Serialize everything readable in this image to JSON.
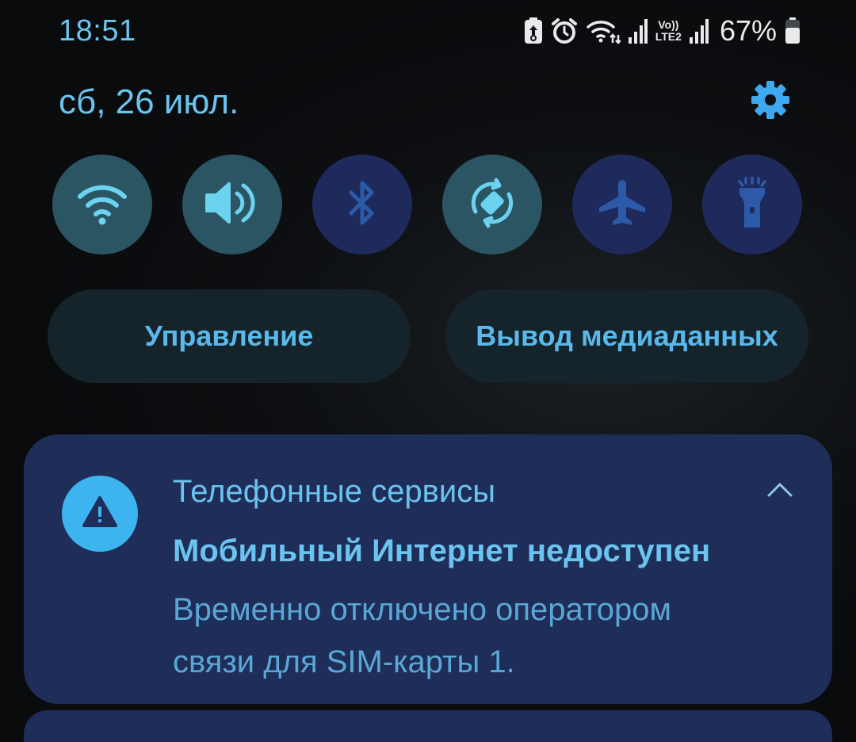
{
  "status_bar": {
    "time": "18:51",
    "icons": [
      "battery-saver-icon",
      "alarm-icon",
      "wifi-data-icon",
      "signal-icon",
      "volte-lte2-icon",
      "signal-icon-2",
      "battery-icon"
    ],
    "volte_label_top": "Vo))",
    "volte_label_bottom": "LTE2",
    "battery_percent": "67%",
    "battery_level": 0.67
  },
  "header": {
    "date": "сб, 26 июл.",
    "settings_icon": "gear-icon"
  },
  "quick_toggles": [
    {
      "name": "wifi",
      "icon": "wifi-icon",
      "state": "on"
    },
    {
      "name": "sound",
      "icon": "volume-icon",
      "state": "on"
    },
    {
      "name": "bluetooth",
      "icon": "bluetooth-icon",
      "state": "off"
    },
    {
      "name": "auto-rotate",
      "icon": "rotate-icon",
      "state": "on"
    },
    {
      "name": "airplane-mode",
      "icon": "airplane-icon",
      "state": "off"
    },
    {
      "name": "flashlight",
      "icon": "flashlight-icon",
      "state": "off"
    }
  ],
  "actions": {
    "device_control": "Управление",
    "media_output": "Вывод медиаданных"
  },
  "notification": {
    "app_name": "Телефонные сервисы",
    "title": "Мобильный Интернет недоступен",
    "body_line1": "Временно отключено оператором",
    "body_line2": "связи для SIM-карты 1.",
    "icon": "warning-icon",
    "expand_icon": "chevron-up-icon"
  },
  "colors": {
    "accent": "#6ac4ef",
    "toggle_on": "#2b5563",
    "toggle_off": "#1f2a5c",
    "card": "#1f2e58",
    "warning_badge": "#3db4f0"
  }
}
